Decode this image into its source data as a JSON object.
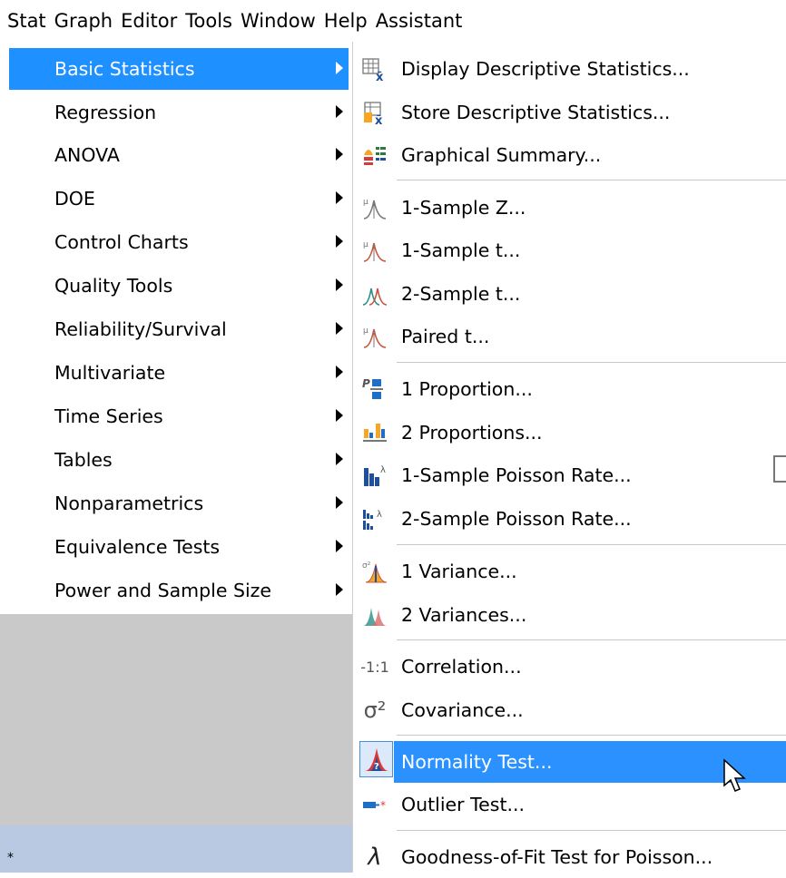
{
  "menubar": {
    "items": [
      "Stat",
      "Graph",
      "Editor",
      "Tools",
      "Window",
      "Help",
      "Assistant"
    ]
  },
  "stat_menu": {
    "items": [
      {
        "label": "Basic Statistics",
        "selected": true
      },
      {
        "label": "Regression"
      },
      {
        "label": "ANOVA"
      },
      {
        "label": "DOE"
      },
      {
        "label": "Control Charts"
      },
      {
        "label": "Quality Tools"
      },
      {
        "label": "Reliability/Survival"
      },
      {
        "label": "Multivariate"
      },
      {
        "label": "Time Series"
      },
      {
        "label": "Tables"
      },
      {
        "label": "Nonparametrics"
      },
      {
        "label": "Equivalence Tests"
      },
      {
        "label": "Power and Sample Size"
      }
    ]
  },
  "submenu": {
    "items": [
      {
        "label": "Display Descriptive Statistics...",
        "icon": "display-descriptive-stats-icon"
      },
      {
        "label": "Store Descriptive Statistics...",
        "icon": "store-descriptive-stats-icon"
      },
      {
        "label": "Graphical Summary...",
        "icon": "graphical-summary-icon"
      },
      {
        "label": "1-Sample Z...",
        "icon": "one-sample-z-icon"
      },
      {
        "label": "1-Sample t...",
        "icon": "one-sample-t-icon"
      },
      {
        "label": "2-Sample t...",
        "icon": "two-sample-t-icon"
      },
      {
        "label": "Paired t...",
        "icon": "paired-t-icon"
      },
      {
        "label": "1 Proportion...",
        "icon": "one-proportion-icon"
      },
      {
        "label": "2 Proportions...",
        "icon": "two-proportions-icon"
      },
      {
        "label": "1-Sample Poisson Rate...",
        "icon": "one-sample-poisson-icon"
      },
      {
        "label": "2-Sample Poisson Rate...",
        "icon": "two-sample-poisson-icon"
      },
      {
        "label": "1 Variance...",
        "icon": "one-variance-icon"
      },
      {
        "label": "2 Variances...",
        "icon": "two-variances-icon"
      },
      {
        "label": "Correlation...",
        "icon": "correlation-icon"
      },
      {
        "label": "Covariance...",
        "icon": "covariance-icon"
      },
      {
        "label": "Normality Test...",
        "icon": "normality-test-icon",
        "selected": true
      },
      {
        "label": "Outlier Test...",
        "icon": "outlier-test-icon"
      },
      {
        "label": "Goodness-of-Fit Test for Poisson...",
        "icon": "lambda-icon"
      }
    ],
    "icon_glyphs": {
      "correlation": "-1:1",
      "covariance": "σ²",
      "lambda": "λ"
    }
  },
  "status": {
    "marker": "*"
  },
  "colors": {
    "selection": "#1e90ff",
    "backdrop": "#c9c9c9",
    "status_bar": "#b8c9e1"
  }
}
